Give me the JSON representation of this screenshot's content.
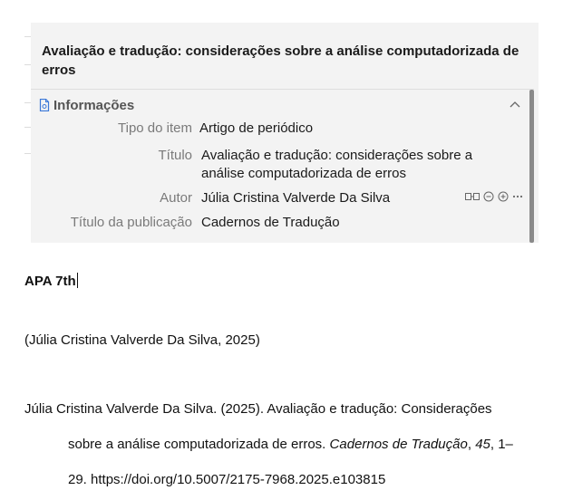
{
  "zotero_panel": {
    "item_title": "Avaliação e tradução: considerações sobre a análise computadorizada de erros",
    "section_header": "Informações",
    "fields": [
      {
        "label": "Tipo do item",
        "value": "Artigo de periódico"
      },
      {
        "label": "Título",
        "value": "Avaliação e tradução: considerações sobre a análise computadorizada de erros"
      },
      {
        "label": "Autor",
        "value": "Júlia Cristina Valverde Da Silva"
      },
      {
        "label": "Título da publicação",
        "value": "Cadernos de Tradução"
      }
    ],
    "icons": [
      "document-icon",
      "chevron-up-icon",
      "swap-name-icon",
      "minus-circle-icon",
      "plus-circle-icon",
      "more-icon"
    ]
  },
  "document": {
    "style_heading": "APA 7th",
    "in_text_citation": "(Júlia Cristina Valverde Da Silva, 2025)",
    "bibliography": {
      "part1": "Júlia Cristina Valverde Da Silva. (2025). Avaliação e tradução: Considerações",
      "part2": "sobre a análise computadorizada de erros. ",
      "journal": "Cadernos de Tradução",
      "sep": ", ",
      "volume": "45",
      "pages": ", 1–",
      "part3": "29. https://doi.org/10.5007/2175-7968.2025.e103815"
    }
  }
}
